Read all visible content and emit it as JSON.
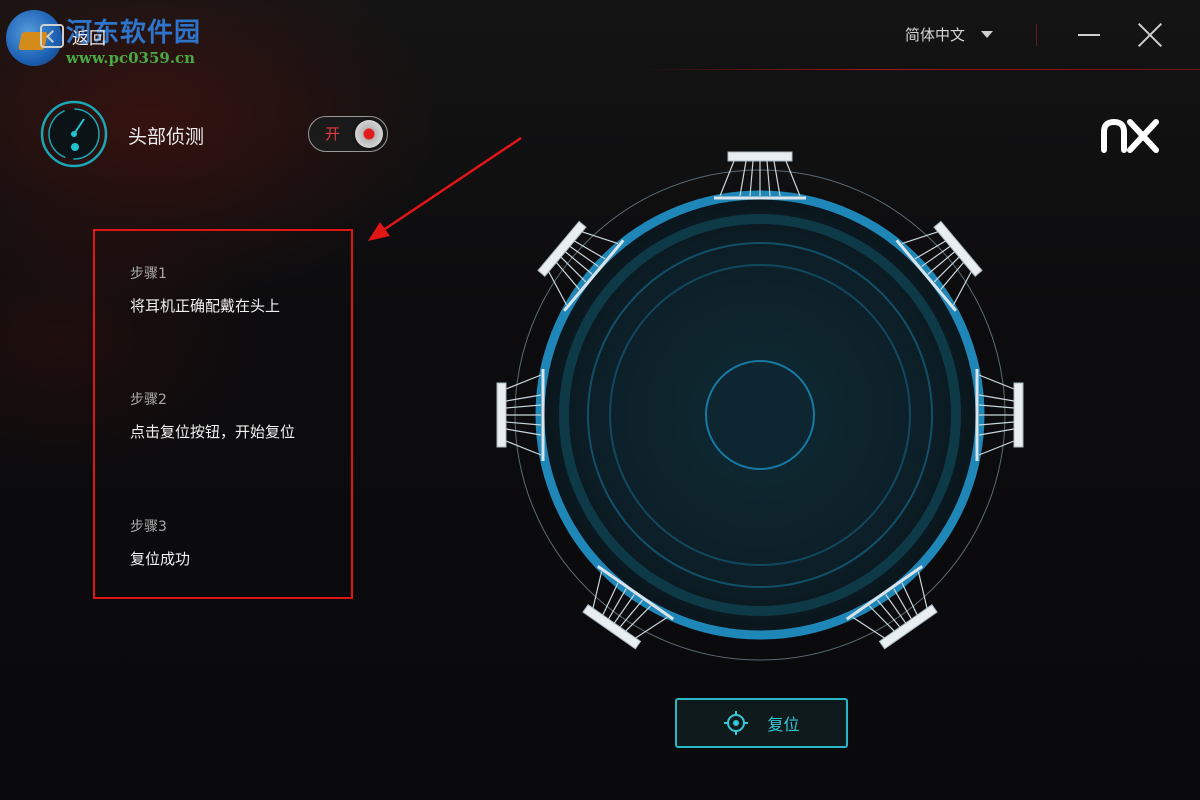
{
  "watermark": {
    "title": "河东软件园",
    "url": "www.pc0359.cn"
  },
  "header": {
    "back_label": "返回",
    "language": "简体中文"
  },
  "head_tracking": {
    "title": "头部侦测",
    "toggle_label": "开",
    "toggle_state": "on"
  },
  "steps": [
    {
      "title": "步骤1",
      "desc": "将耳机正确配戴在头上"
    },
    {
      "title": "步骤2",
      "desc": "点击复位按钮，开始复位"
    },
    {
      "title": "步骤3",
      "desc": "复位成功"
    }
  ],
  "reset_button": {
    "label": "复位"
  },
  "colors": {
    "accent": "#27b7c6",
    "ring": "#1f86b8",
    "annotation": "#e01515",
    "toggle_on": "#e23b3b"
  },
  "icons": [
    "back-icon",
    "radar-icon",
    "nx-logo",
    "speaker-icon",
    "target-icon",
    "chevron-down-icon",
    "minimize-icon",
    "close-icon"
  ]
}
